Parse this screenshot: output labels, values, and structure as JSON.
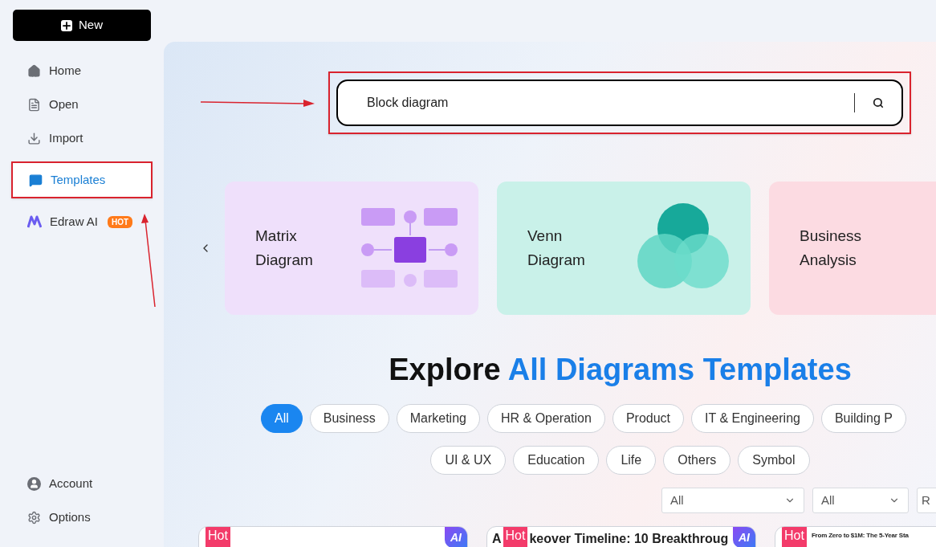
{
  "sidebar": {
    "new_button": "New",
    "items": [
      {
        "label": "Home",
        "kind": "home",
        "selected": false
      },
      {
        "label": "Open",
        "kind": "file",
        "selected": false
      },
      {
        "label": "Import",
        "kind": "import",
        "selected": false
      },
      {
        "label": "Templates",
        "kind": "templates",
        "selected": true
      },
      {
        "label": "Edraw AI",
        "kind": "ai",
        "selected": false,
        "badge": "HOT"
      }
    ],
    "bottom_items": [
      {
        "label": "Account",
        "kind": "account"
      },
      {
        "label": "Options",
        "kind": "settings"
      }
    ]
  },
  "search": {
    "value": "Block diagram"
  },
  "carousel": [
    {
      "title": "Matrix Diagram",
      "kind": "matrix"
    },
    {
      "title": "Venn Diagram",
      "kind": "venn"
    },
    {
      "title": "Business Analysis",
      "kind": "business"
    }
  ],
  "heading": {
    "text": "Explore",
    "highlight": "All Diagrams Templates"
  },
  "categories": [
    [
      {
        "label": "All",
        "selected": true
      },
      {
        "label": "Business",
        "selected": false
      },
      {
        "label": "Marketing",
        "selected": false
      },
      {
        "label": "HR & Operation",
        "selected": false
      },
      {
        "label": "Product",
        "selected": false
      },
      {
        "label": "IT & Engineering",
        "selected": false
      },
      {
        "label": "Building P",
        "selected": false
      }
    ],
    [
      {
        "label": "UI & UX",
        "selected": false
      },
      {
        "label": "Education",
        "selected": false
      },
      {
        "label": "Life",
        "selected": false
      },
      {
        "label": "Others",
        "selected": false
      },
      {
        "label": "Symbol",
        "selected": false
      }
    ]
  ],
  "filters": [
    "All",
    "All",
    "R"
  ],
  "templates": [
    {
      "hot": "Hot",
      "ai": "AI"
    },
    {
      "hot": "Hot",
      "ai": "AI",
      "title_parts": [
        "A",
        "keover Timeline: 10 Breakthroug"
      ]
    },
    {
      "hot": "Hot",
      "title_parts": [
        "From Zero to $1M: The 5-Year Sta"
      ]
    }
  ]
}
